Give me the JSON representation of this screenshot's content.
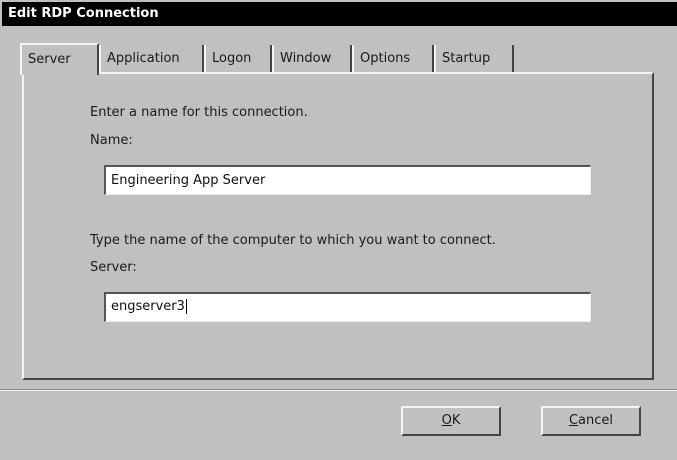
{
  "window": {
    "title": "Edit RDP Connection"
  },
  "tabs": [
    {
      "label": "Server",
      "active": true
    },
    {
      "label": "Application",
      "active": false
    },
    {
      "label": "Logon",
      "active": false
    },
    {
      "label": "Window",
      "active": false
    },
    {
      "label": "Options",
      "active": false
    },
    {
      "label": "Startup",
      "active": false
    }
  ],
  "server_tab": {
    "connection_prompt": "Enter a name for this connection.",
    "name_label": "Name:",
    "name_value": "Engineering App Server",
    "server_prompt": "Type the name of the computer to which you want to connect.",
    "server_label": "Server:",
    "server_value": "engserver3"
  },
  "buttons": {
    "ok": {
      "mnemonic": "O",
      "rest": "K"
    },
    "cancel": {
      "mnemonic": "C",
      "rest": "ancel"
    }
  },
  "colors": {
    "window_bg": "#c0c0c0",
    "titlebar_bg": "#000000",
    "titlebar_text": "#ffffff"
  }
}
